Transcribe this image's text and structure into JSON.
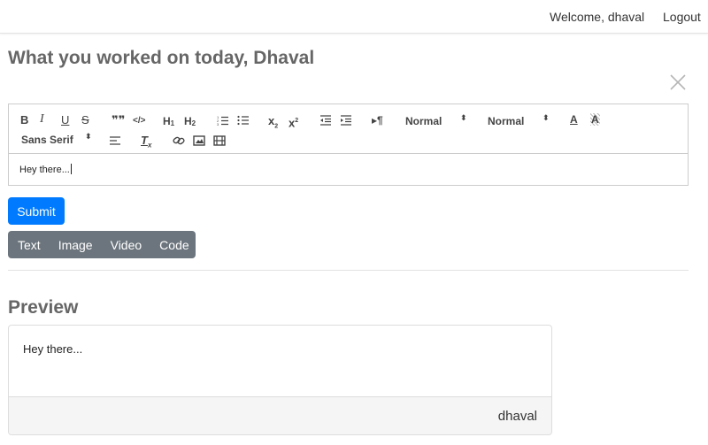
{
  "nav": {
    "welcome": "Welcome, dhaval",
    "logout": "Logout"
  },
  "page_title": "What you worked on today, Dhaval",
  "toolbar": {
    "bold": "B",
    "italic": "I",
    "underline": "U",
    "strike": "S",
    "blockquote": "❞❞",
    "code": "</>",
    "h1": "H",
    "h1_sub": "1",
    "h2": "H",
    "h2_sub": "2",
    "subscript": "x",
    "subscript_sub": "2",
    "superscript": "x",
    "superscript_sup": "2",
    "header_picker": "Normal",
    "size_picker": "Normal",
    "font_picker": "Sans Serif",
    "picker_arrows": "⬍",
    "color": "A",
    "background": "A",
    "clean": "T",
    "clean_sub": "x",
    "rtl": "▸¶"
  },
  "editor": {
    "content": "Hey there..."
  },
  "buttons": {
    "submit": "Submit",
    "group": [
      "Text",
      "Image",
      "Video",
      "Code"
    ]
  },
  "preview": {
    "title": "Preview",
    "body": "Hey there...",
    "author": "dhaval"
  },
  "colors": {
    "primary": "#007bff",
    "secondary": "#6c757d",
    "heading": "#666666"
  },
  "icons": {
    "close": "close-icon",
    "ordered_list": "ordered-list-icon",
    "bullet_list": "bullet-list-icon",
    "outdent": "outdent-icon",
    "indent": "indent-icon",
    "align": "align-left-icon",
    "link": "link-icon",
    "image": "image-icon",
    "video": "video-icon"
  }
}
